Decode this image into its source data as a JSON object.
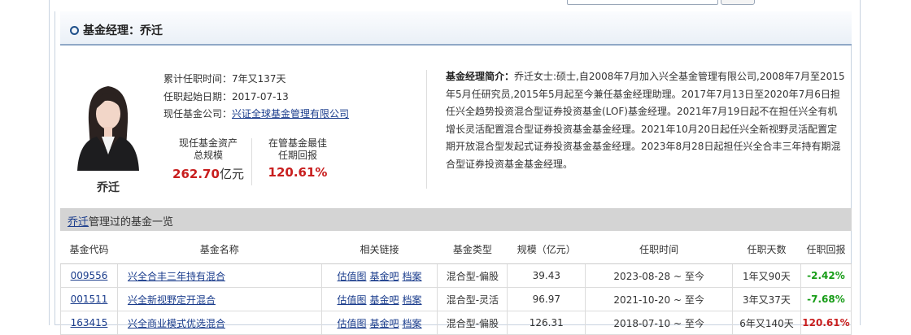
{
  "manager": {
    "header_title": "基金经理：乔迁",
    "name": "乔迁",
    "tenure_label": "累计任职时间：",
    "tenure_value": "7年又137天",
    "start_label": "任职起始日期：",
    "start_value": "2017-07-13",
    "company_label": "现任基金公司：",
    "company_value": "兴证全球基金管理有限公司",
    "assets_label_1": "现任基金资产",
    "assets_label_2": "总规模",
    "assets_value": "262.70",
    "assets_unit": "亿元",
    "return_label_1": "在管基金最佳",
    "return_label_2": "任期回报",
    "return_value": "120.61%",
    "bio_label": "基金经理简介：",
    "bio_text": "乔迁女士:硕士,自2008年7月加入兴全基金管理有限公司,2008年7月至2015年5月任研究员,2015年5月起至今兼任基金经理助理。2017年7月13日至2020年7月6日担任兴全趋势投资混合型证券投资基金(LOF)基金经理。2021年7月19日起不在担任兴全有机增长灵活配置混合型证券投资基金基金经理。2021年10月20日起任兴全新视野灵活配置定期开放混合型发起式证券投资基金基金经理。2023年8月28日起担任兴全合丰三年持有期混合型证券投资基金基金经理。"
  },
  "funds_section": {
    "name_link": "乔迁",
    "title_rest": "管理过的基金一览"
  },
  "table": {
    "headers": [
      "基金代码",
      "基金名称",
      "相关链接",
      "基金类型",
      "规模（亿元）",
      "任职时间",
      "任职天数",
      "任职回报"
    ],
    "link_labels": [
      "估值图",
      "基金吧",
      "档案"
    ],
    "rows": [
      {
        "code": "009556",
        "name": "兴全合丰三年持有混合",
        "type": "混合型-偏股",
        "size": "39.43",
        "period": "2023-08-28 ~ 至今",
        "days": "1年又90天",
        "return": "-2.42%"
      },
      {
        "code": "001511",
        "name": "兴全新视野定开混合",
        "type": "混合型-灵活",
        "size": "96.97",
        "period": "2021-10-20 ~ 至今",
        "days": "3年又37天",
        "return": "-7.68%"
      },
      {
        "code": "163415",
        "name": "兴全商业模式优选混合",
        "type": "混合型-偏股",
        "size": "126.31",
        "period": "2018-07-10 ~ 至今",
        "days": "6年又140天",
        "return": "120.61%"
      }
    ]
  },
  "colors": {
    "accent_blue": "#1a3c8c",
    "value_red": "#c81e1e",
    "value_green": "#169c16"
  }
}
